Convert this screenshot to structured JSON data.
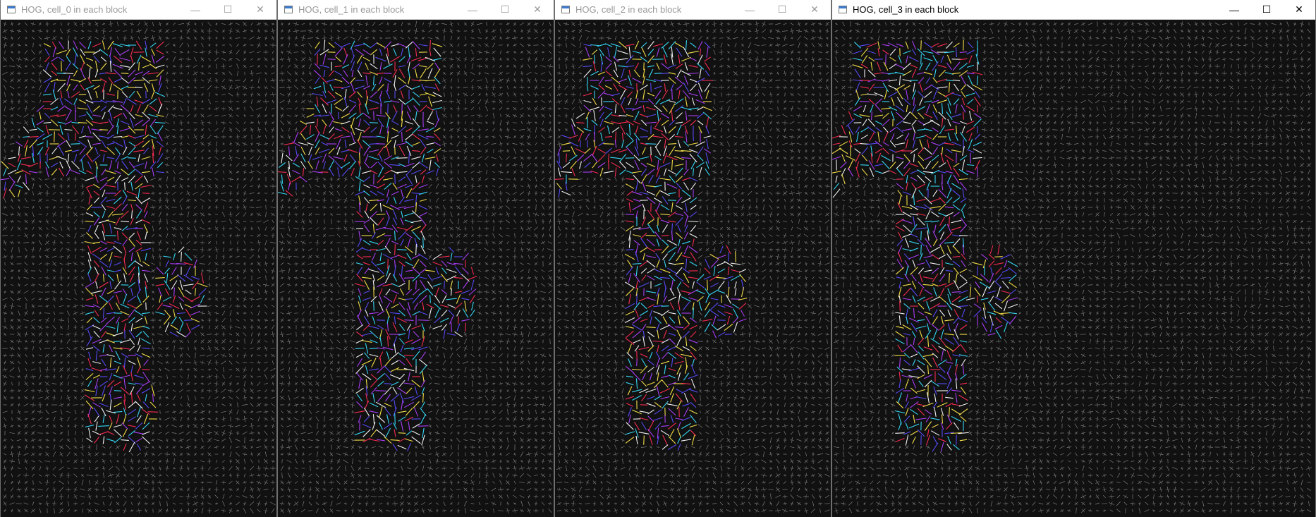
{
  "windows": [
    {
      "title": "HOG, cell_0 in each block",
      "active": false,
      "buttons": {
        "minimize": "—",
        "maximize": "☐",
        "close": "✕"
      },
      "canvas": "hog-cell0"
    },
    {
      "title": "HOG, cell_1 in each block",
      "active": false,
      "buttons": {
        "minimize": "—",
        "maximize": "☐",
        "close": "✕"
      },
      "canvas": "hog-cell1"
    },
    {
      "title": "HOG, cell_2 in each block",
      "active": false,
      "buttons": {
        "minimize": "—",
        "maximize": "☐",
        "close": "✕"
      },
      "canvas": "hog-cell2"
    },
    {
      "title": "HOG, cell_3 in each block",
      "active": true,
      "buttons": {
        "minimize": "—",
        "maximize": "☐",
        "close": "✕"
      },
      "canvas": "hog-cell3"
    }
  ],
  "colors": {
    "background": "#111111",
    "grid_glyph": "#d8d8d8",
    "edge_palette": [
      "#ff2d55",
      "#ffe84d",
      "#38e0ff",
      "#5a4dff",
      "#b040ff",
      "#ffffff"
    ]
  }
}
